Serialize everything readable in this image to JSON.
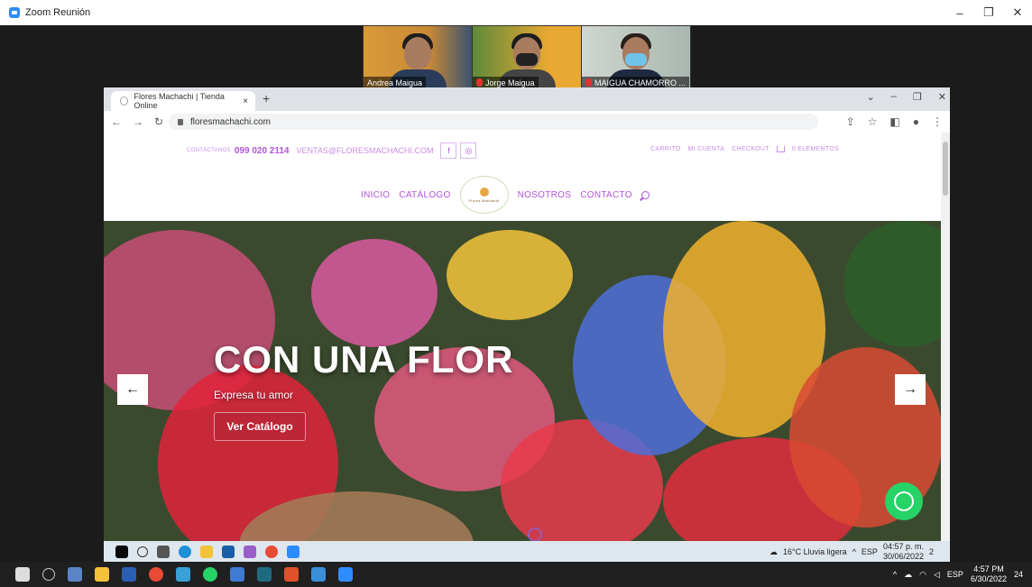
{
  "zoom": {
    "title": "Zoom Reunión",
    "participants": [
      {
        "name": "Andrea Maigua",
        "muted": false
      },
      {
        "name": "Jorge Maigua",
        "muted": true
      },
      {
        "name": "MAIGUA CHAMORRO ...",
        "muted": true
      }
    ]
  },
  "browser": {
    "tab_title": "Flores Machachi | Tienda Online",
    "tab_close": "×",
    "new_tab": "+",
    "url": "floresmachachi.com"
  },
  "site": {
    "contact_label": "CONTÁCTANOS",
    "phone": "099 020 2114",
    "email": "VENTAS@FLORESMACHACHI.COM",
    "social": [
      "f",
      "◎"
    ],
    "shop_links": [
      "CARRITO",
      "MI CUENTA",
      "CHECKOUT"
    ],
    "cart_count": "0 ELEMENTOS",
    "nav_left": [
      "INICIO",
      "CATÁLOGO"
    ],
    "nav_right": [
      "NOSOTROS",
      "CONTACTO"
    ],
    "logo_text": "Flores Machachi"
  },
  "hero": {
    "title": "CON UNA FLOR",
    "subtitle": "Expresa tu amor",
    "button": "Ver Catálogo",
    "prev": "←",
    "next": "→"
  },
  "inner_taskbar": {
    "weather": "16°C  Lluvia ligera",
    "lang": "ESP",
    "time": "04:57 p. m.",
    "date": "30/06/2022",
    "notif": "2"
  },
  "taskbar": {
    "lang": "ESP",
    "time": "4:57 PM",
    "date": "6/30/2022",
    "notif": "24"
  },
  "colors": {
    "brand_purple": "#b055d8",
    "whatsapp": "#25d366"
  }
}
